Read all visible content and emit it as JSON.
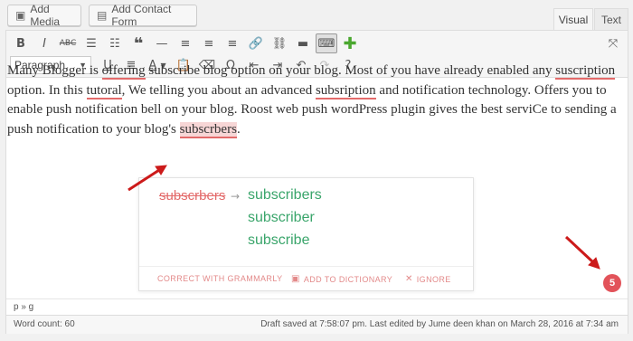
{
  "header": {
    "add_media": "Add Media",
    "add_contact_form": "Add Contact Form",
    "tabs": [
      {
        "label": "Visual",
        "active": true
      },
      {
        "label": "Text",
        "active": false
      }
    ]
  },
  "toolbar": {
    "format_value": "Paragraph",
    "row1_icons": [
      "bold-icon",
      "italic-icon",
      "strikethrough-icon",
      "bullet-list-icon",
      "numbered-list-icon",
      "blockquote-icon",
      "horizontal-line-icon",
      "align-left-icon",
      "align-center-icon",
      "align-right-icon",
      "link-icon",
      "unlink-icon",
      "read-more-icon",
      "toolbar-toggle-icon",
      "add-icon"
    ],
    "row2_icons": [
      "underline-icon",
      "justify-icon",
      "text-color-icon",
      "paste-as-text-icon",
      "clear-formatting-icon",
      "special-character-icon",
      "outdent-icon",
      "indent-icon",
      "undo-icon",
      "redo-icon",
      "help-icon"
    ],
    "fullscreen_icon": "fullscreen-icon"
  },
  "content": {
    "t1": "Many Blogger is ",
    "w_offering": "offering",
    "t2": " subscribe blog option on your blog. Most of you have already enabled any ",
    "w_suscription": "suscription",
    "t3": " option. In this ",
    "w_tutoral": "tutoral",
    "t4": ", We telling you about an advanced ",
    "w_subsription": "subsription",
    "t5": " and notification technology. Offers you to enable push notification bell on your blog. Roost web push wordPress plugin gives the best serviCe to sending a push notification to your blog's ",
    "w_subscrbers": "subscrbers",
    "t6": "."
  },
  "grammarly": {
    "original": "subscrbers",
    "arrow": "→",
    "suggestions": [
      "subscribers",
      "subscriber",
      "subscribe"
    ],
    "actions": {
      "correct": "CORRECT WITH GRAMMARLY",
      "dictionary": "ADD TO DICTIONARY",
      "ignore": "IGNORE"
    },
    "badge_count": "5"
  },
  "footer": {
    "path": "p » g",
    "word_count": "Word count: 60",
    "draft_status": "Draft saved at 7:58:07 pm. Last edited by Jume deen khan on March 28, 2016 at 7:34 am"
  },
  "colors": {
    "error_red": "#e36a6a",
    "suggestion_green": "#3aa56b",
    "annotation_arrow": "#cc1a1a",
    "badge": "#e2535a"
  }
}
